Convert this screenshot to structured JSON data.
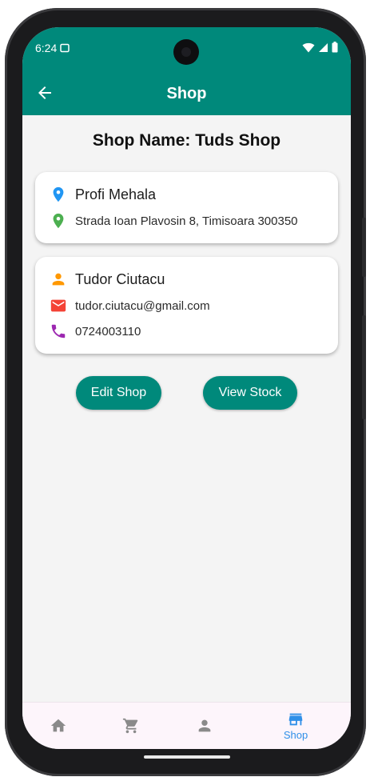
{
  "status_bar": {
    "time": "6:24"
  },
  "app_bar": {
    "title": "Shop"
  },
  "shop": {
    "heading": "Shop Name: Tuds Shop"
  },
  "location_card": {
    "name": "Profi Mehala",
    "address": "Strada Ioan Plavosin 8, Timisoara 300350"
  },
  "contact_card": {
    "person": "Tudor Ciutacu",
    "email": "tudor.ciutacu@gmail.com",
    "phone": "0724003110"
  },
  "actions": {
    "edit_label": "Edit Shop",
    "stock_label": "View Stock"
  },
  "bottom_nav": {
    "items": [
      {
        "icon": "home-icon",
        "label": ""
      },
      {
        "icon": "cart-icon",
        "label": ""
      },
      {
        "icon": "person-icon",
        "label": ""
      },
      {
        "icon": "store-icon",
        "label": "Shop",
        "active": true
      }
    ]
  },
  "colors": {
    "primary": "#00897b",
    "location_icon": "#2196f3",
    "address_icon": "#4caf50",
    "person_icon": "#ff9800",
    "email_icon": "#f44336",
    "phone_icon": "#9c27b0",
    "nav_active": "#2f8fe8",
    "nav_inactive": "#8a8a8a"
  }
}
